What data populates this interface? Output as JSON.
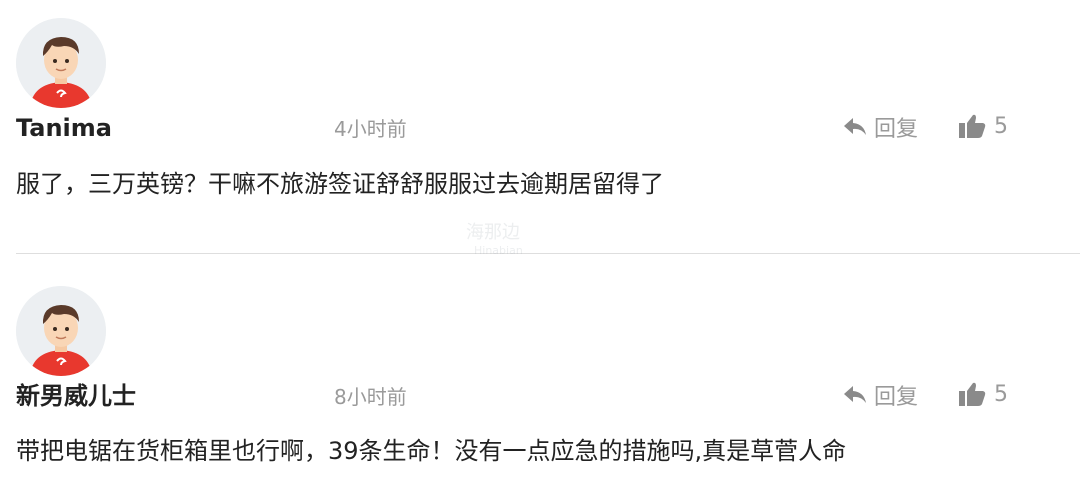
{
  "comments": [
    {
      "username": "Tanima",
      "time": "4小时前",
      "reply_label": "回复",
      "like_count": "5",
      "content": "服了，三万英镑？干嘛不旅游签证舒舒服服过去逾期居留得了"
    },
    {
      "username": "新男威儿士",
      "time": "8小时前",
      "reply_label": "回复",
      "like_count": "5",
      "content": "带把电锯在货柜箱里也行啊，39条生命！没有一点应急的措施吗,真是草菅人命"
    }
  ],
  "watermark": {
    "cn": "海那边",
    "en": "Hinabian"
  },
  "icons": {
    "reply": "reply-arrow-icon",
    "like": "thumbs-up-icon"
  },
  "colors": {
    "text": "#222222",
    "muted": "#9a9a9a",
    "avatar_shirt": "#e8382e",
    "divider": "#dedede"
  }
}
